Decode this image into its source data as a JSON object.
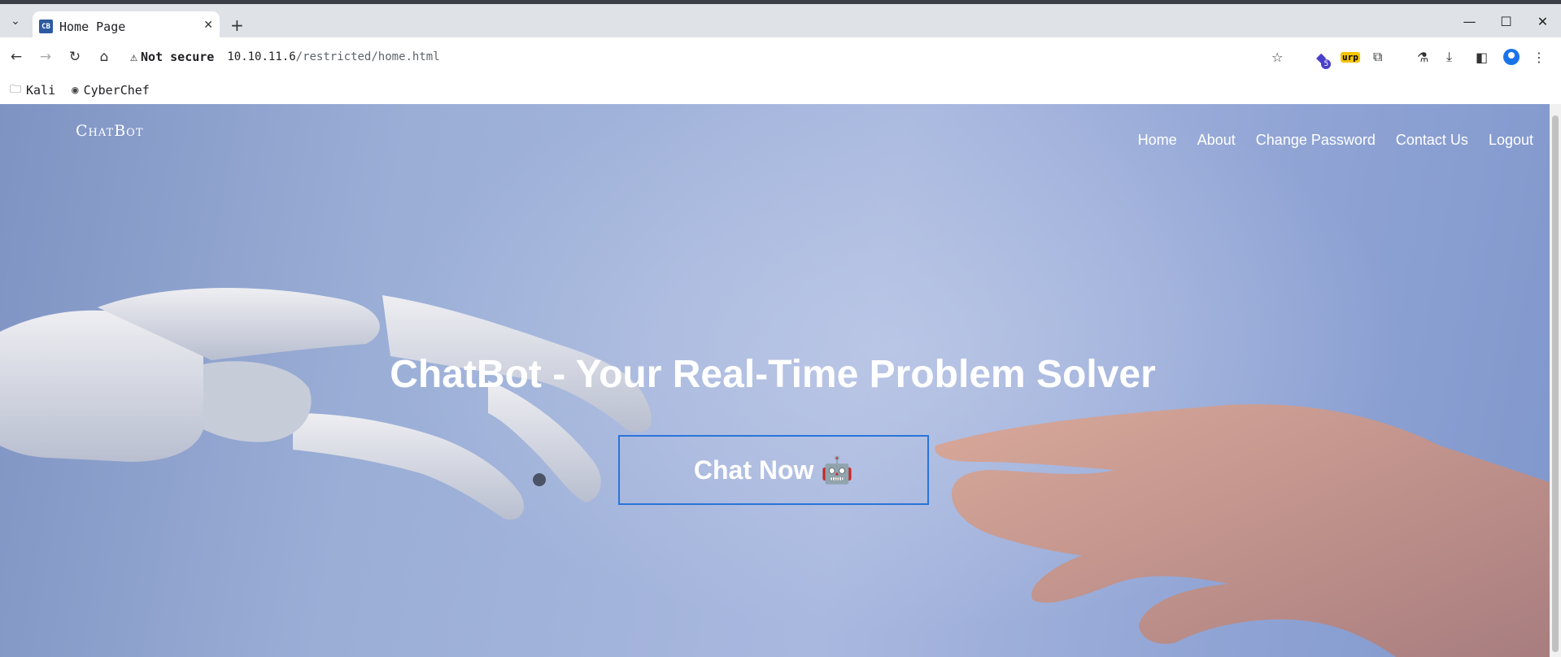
{
  "browser": {
    "tab": {
      "favicon_text": "CB",
      "title": "Home Page"
    },
    "address": {
      "security_label": "Not secure",
      "url_host": "10.10.11.6",
      "url_path": "/restricted/home.html"
    },
    "extensions": {
      "badge_count": "5",
      "burp_label": "urp"
    },
    "bookmarks": [
      {
        "label": "Kali",
        "icon": "folder-icon"
      },
      {
        "label": "CyberChef",
        "icon": "chef-icon"
      }
    ]
  },
  "page": {
    "brand": "ChatBot",
    "nav": [
      "Home",
      "About",
      "Change Password",
      "Contact Us",
      "Logout"
    ],
    "hero_title": "ChatBot - Your Real-Time Problem Solver",
    "cta_label": "Chat Now 🤖"
  },
  "colors": {
    "cta_border": "#2a73d9",
    "text_on_hero": "#ffffff"
  }
}
